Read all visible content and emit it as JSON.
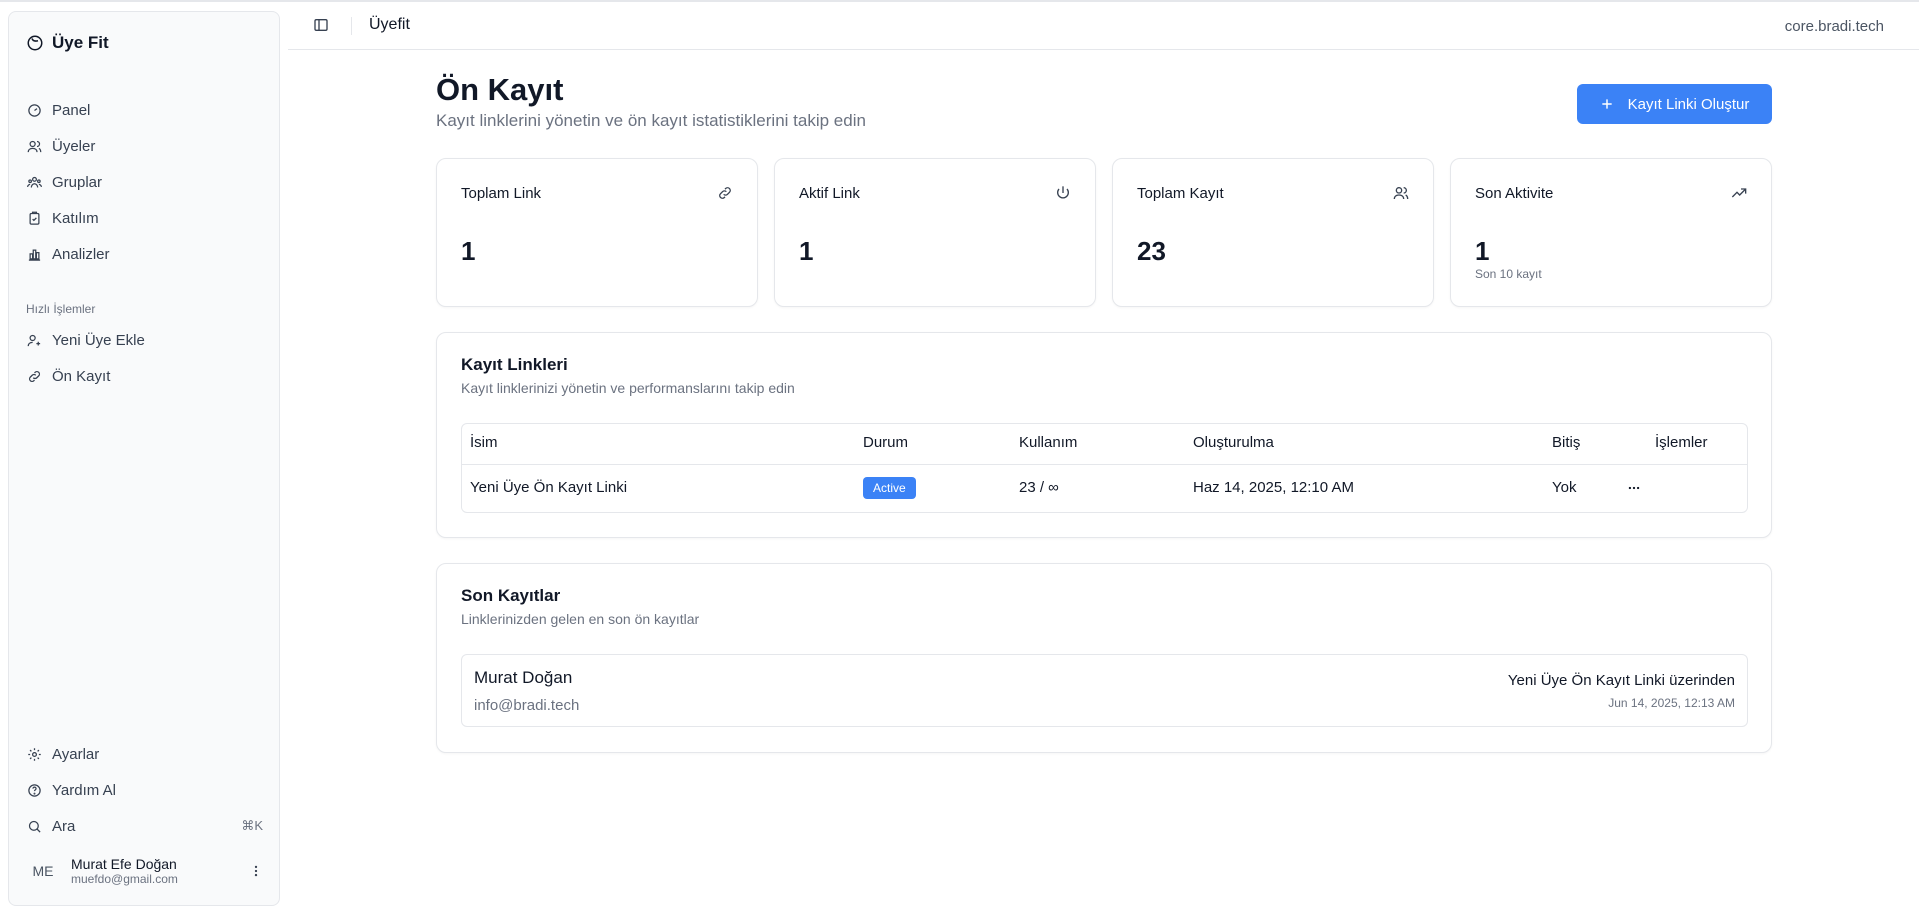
{
  "sidebar": {
    "brand": "Üye Fit",
    "nav": [
      {
        "label": "Panel",
        "icon": "gauge-icon"
      },
      {
        "label": "Üyeler",
        "icon": "users-icon"
      },
      {
        "label": "Gruplar",
        "icon": "groups-icon"
      },
      {
        "label": "Katılım",
        "icon": "clipboard-check-icon"
      },
      {
        "label": "Analizler",
        "icon": "bar-chart-icon"
      }
    ],
    "quick_label": "Hızlı İşlemler",
    "quick": [
      {
        "label": "Yeni Üye Ekle",
        "icon": "user-plus-icon"
      },
      {
        "label": "Ön Kayıt",
        "icon": "link-icon"
      }
    ],
    "bottom": [
      {
        "label": "Ayarlar",
        "icon": "gear-icon"
      },
      {
        "label": "Yardım Al",
        "icon": "help-circle-icon"
      },
      {
        "label": "Ara",
        "icon": "search-icon",
        "shortcut": "⌘K"
      }
    ],
    "user": {
      "initials": "ME",
      "name": "Murat Efe Doğan",
      "email": "muefdo@gmail.com"
    }
  },
  "header": {
    "title": "Üyefit",
    "host": "core.bradi.tech"
  },
  "page": {
    "title": "Ön Kayıt",
    "subtitle": "Kayıt linklerini yönetin ve ön kayıt istatistiklerini takip edin",
    "create_button": "Kayıt Linki Oluştur"
  },
  "stats": [
    {
      "label": "Toplam Link",
      "value": "1",
      "note": "",
      "icon": "link-icon"
    },
    {
      "label": "Aktif Link",
      "value": "1",
      "note": "",
      "icon": "power-icon"
    },
    {
      "label": "Toplam Kayıt",
      "value": "23",
      "note": "",
      "icon": "users-icon"
    },
    {
      "label": "Son Aktivite",
      "value": "1",
      "note": "Son 10 kayıt",
      "icon": "trending-up-icon"
    }
  ],
  "links_panel": {
    "title": "Kayıt Linkleri",
    "subtitle": "Kayıt linklerinizi yönetin ve performanslarını takip edin",
    "columns": [
      "İsim",
      "Durum",
      "Kullanım",
      "Oluşturulma",
      "Bitiş",
      "İşlemler"
    ],
    "rows": [
      {
        "name": "Yeni Üye Ön Kayıt Linki",
        "status": "Active",
        "usage": "23 / ∞",
        "created": "Haz 14, 2025, 12:10 AM",
        "expires": "Yok"
      }
    ]
  },
  "recent_panel": {
    "title": "Son Kayıtlar",
    "subtitle": "Linklerinizden gelen en son ön kayıtlar",
    "items": [
      {
        "name": "Murat Doğan",
        "email": "info@bradi.tech",
        "source": "Yeni Üye Ön Kayıt Linki üzerinden",
        "date": "Jun 14, 2025, 12:13 AM"
      }
    ]
  },
  "colors": {
    "accent": "#3b82f6",
    "border": "#e5e7eb",
    "muted": "#6b7280"
  }
}
